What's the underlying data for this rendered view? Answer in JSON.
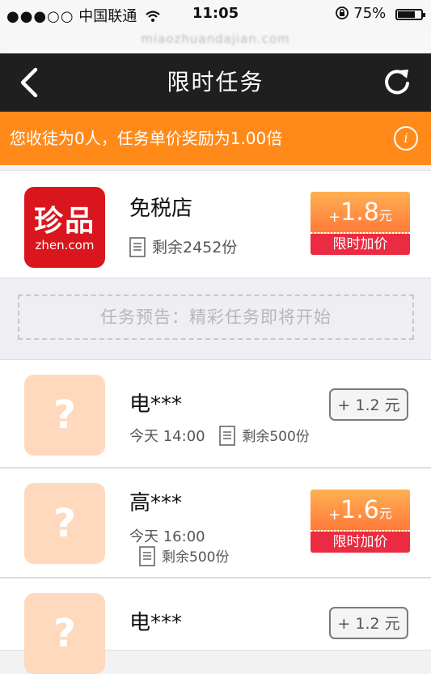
{
  "status_bar": {
    "signal": "●●●○○",
    "carrier": "中国联通",
    "time": "11:05",
    "battery_percent": "75%",
    "battery_level": 0.75
  },
  "url_bar": {
    "text": "miaozhuandajian.com"
  },
  "header": {
    "title": "限时任务",
    "back_icon": "chevron-left-icon",
    "refresh_icon": "refresh-icon"
  },
  "banner": {
    "text": "您收徒为0人，任务单价奖励为1.00倍",
    "info_icon": "i"
  },
  "tasks": [
    {
      "logo_big": "珍品",
      "logo_small": "zhen.com",
      "name": "免税店",
      "stock": "剩余2452份",
      "badge": {
        "plus": "+",
        "amount": "1.8",
        "unit": "元",
        "tag": "限时加价"
      }
    },
    {
      "placeholder": "?",
      "name": "电***",
      "time": "今天 14:00",
      "stock": "剩余500份",
      "pill": "+ 1.2 元"
    },
    {
      "placeholder": "?",
      "name": "高***",
      "time": "今天 16:00",
      "stock": "剩余500份",
      "badge": {
        "plus": "+",
        "amount": "1.6",
        "unit": "元",
        "tag": "限时加价"
      }
    },
    {
      "placeholder": "?",
      "name": "电***",
      "pill": "+ 1.2 元"
    }
  ],
  "notice": {
    "text": "任务预告：精彩任务即将开始"
  },
  "colors": {
    "header_bg": "#1f1f1f",
    "banner_bg": "#ff8a1a",
    "badge_gradient_top": "#ffb052",
    "badge_gradient_bottom": "#ff7a3a",
    "badge_tag_bg": "#ea2b42",
    "placeholder_bg": "#ffd9bd",
    "logo_bg": "#d9161d"
  }
}
